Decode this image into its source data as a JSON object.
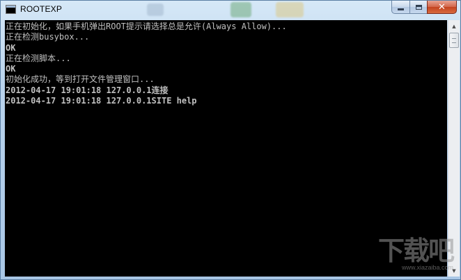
{
  "window": {
    "title": "ROOTEXP",
    "controls": {
      "minimize_icon": "minimize-icon",
      "maximize_icon": "maximize-icon",
      "close_label": "✕"
    }
  },
  "console": {
    "background": "#000000",
    "text_color": "#c0c0c0",
    "lines": [
      {
        "text": "正在初始化，如果手机弹出ROOT提示请选择总是允许(Always Allow)...",
        "bold": false
      },
      {
        "text": "正在检测busybox...",
        "bold": false
      },
      {
        "text": "OK",
        "bold": true
      },
      {
        "text": "正在检测脚本...",
        "bold": false
      },
      {
        "text": "OK",
        "bold": true
      },
      {
        "text": "初始化成功，等到打开文件管理窗口...",
        "bold": false
      },
      {
        "text": "2012-04-17 19:01:18 127.0.0.1连接",
        "bold": true
      },
      {
        "text": "2012-04-17 19:01:18 127.0.0.1SITE help",
        "bold": true
      }
    ]
  },
  "watermark": {
    "main": "下载吧",
    "sub": "www.xiazaiba.com"
  }
}
